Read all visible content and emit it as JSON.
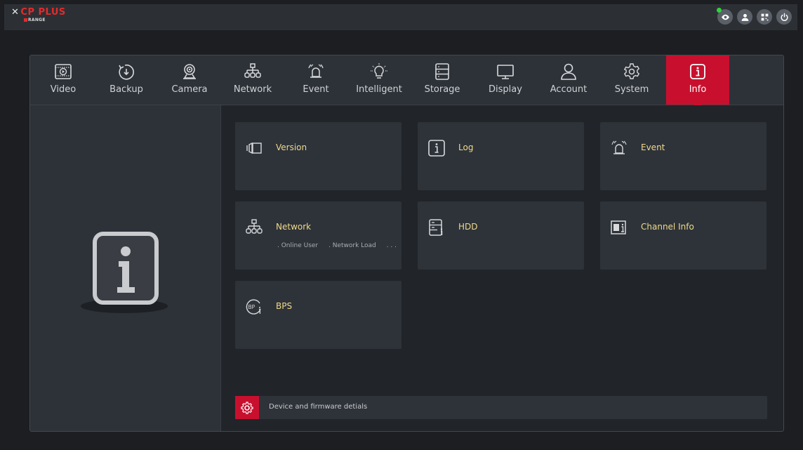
{
  "brand": {
    "name": "CP PLUS",
    "sub": "RANGE"
  },
  "top_icons": [
    {
      "name": "eye-icon"
    },
    {
      "name": "user-icon"
    },
    {
      "name": "qr-icon"
    },
    {
      "name": "power-icon"
    }
  ],
  "tabs": [
    {
      "label": "Video",
      "icon": "video-icon"
    },
    {
      "label": "Backup",
      "icon": "backup-icon"
    },
    {
      "label": "Camera",
      "icon": "camera-icon"
    },
    {
      "label": "Network",
      "icon": "network-icon"
    },
    {
      "label": "Event",
      "icon": "alarm-icon"
    },
    {
      "label": "Intelligent",
      "icon": "bulb-icon"
    },
    {
      "label": "Storage",
      "icon": "storage-icon"
    },
    {
      "label": "Display",
      "icon": "monitor-icon"
    },
    {
      "label": "Account",
      "icon": "account-icon"
    },
    {
      "label": "System",
      "icon": "gear-icon"
    },
    {
      "label": "Info",
      "icon": "info-icon",
      "active": true
    }
  ],
  "cards": [
    {
      "title": "Version",
      "icon": "version-icon"
    },
    {
      "title": "Log",
      "icon": "log-icon"
    },
    {
      "title": "Event",
      "icon": "event-alarm-icon"
    },
    {
      "title": "Network",
      "icon": "network-tree-icon",
      "sub": [
        ". Online User",
        ". Network Load",
        ". . ."
      ]
    },
    {
      "title": "HDD",
      "icon": "hdd-icon"
    },
    {
      "title": "Channel Info",
      "icon": "channel-info-icon"
    },
    {
      "title": "BPS",
      "icon": "bps-icon"
    }
  ],
  "footer": {
    "text": "Device and firmware detials"
  },
  "colors": {
    "accent": "#c8102e",
    "card_title": "#f0d98a",
    "status_dot": "#2fd33a"
  }
}
